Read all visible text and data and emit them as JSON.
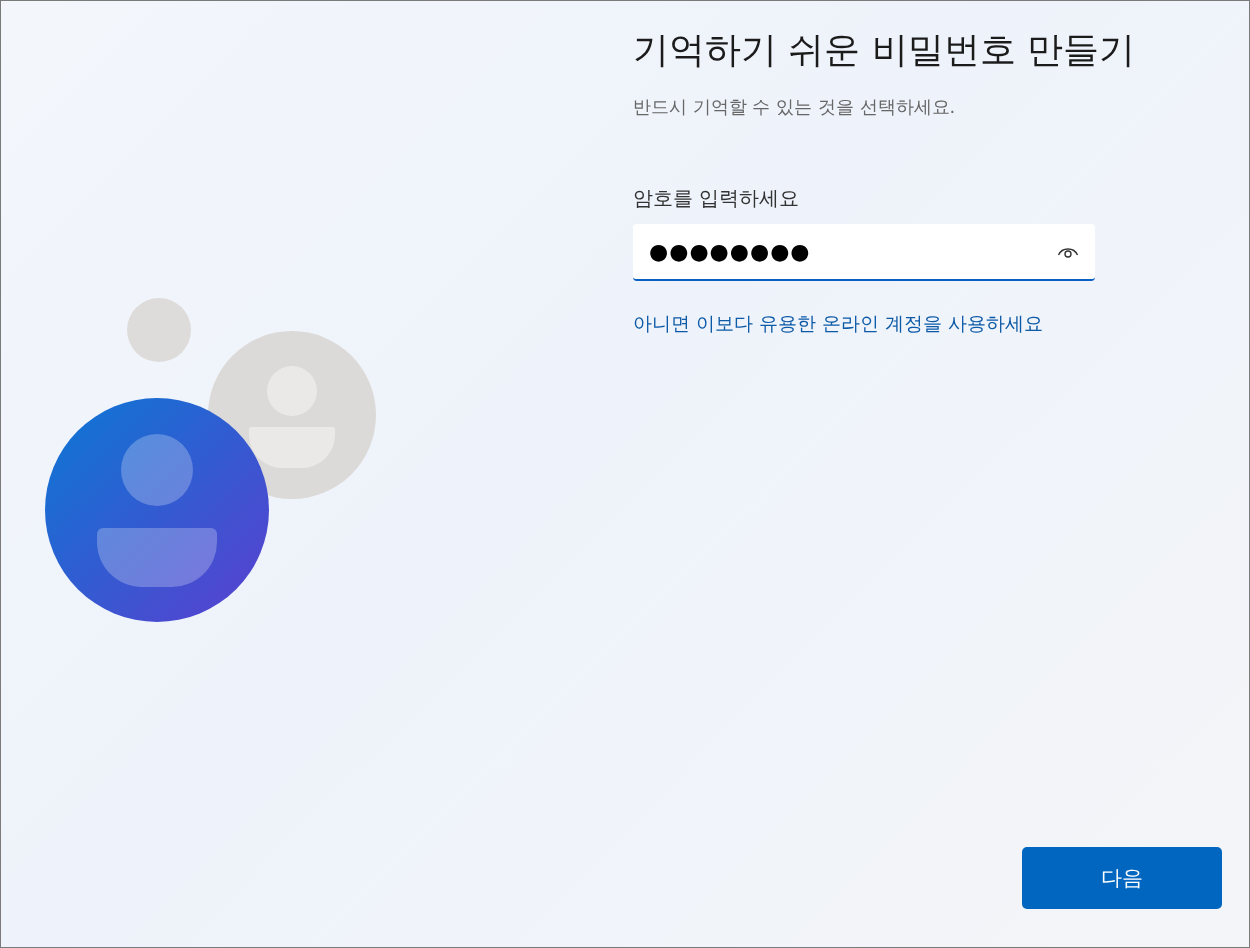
{
  "title": "기억하기 쉬운 비밀번호 만들기",
  "subtitle": "반드시 기억할 수 있는 것을 선택하세요.",
  "password_field": {
    "label": "암호를 입력하세요",
    "value": "●●●●●●●●"
  },
  "link": "아니면 이보다 유용한 온라인 계정을 사용하세요",
  "buttons": [
    "다음"
  ]
}
